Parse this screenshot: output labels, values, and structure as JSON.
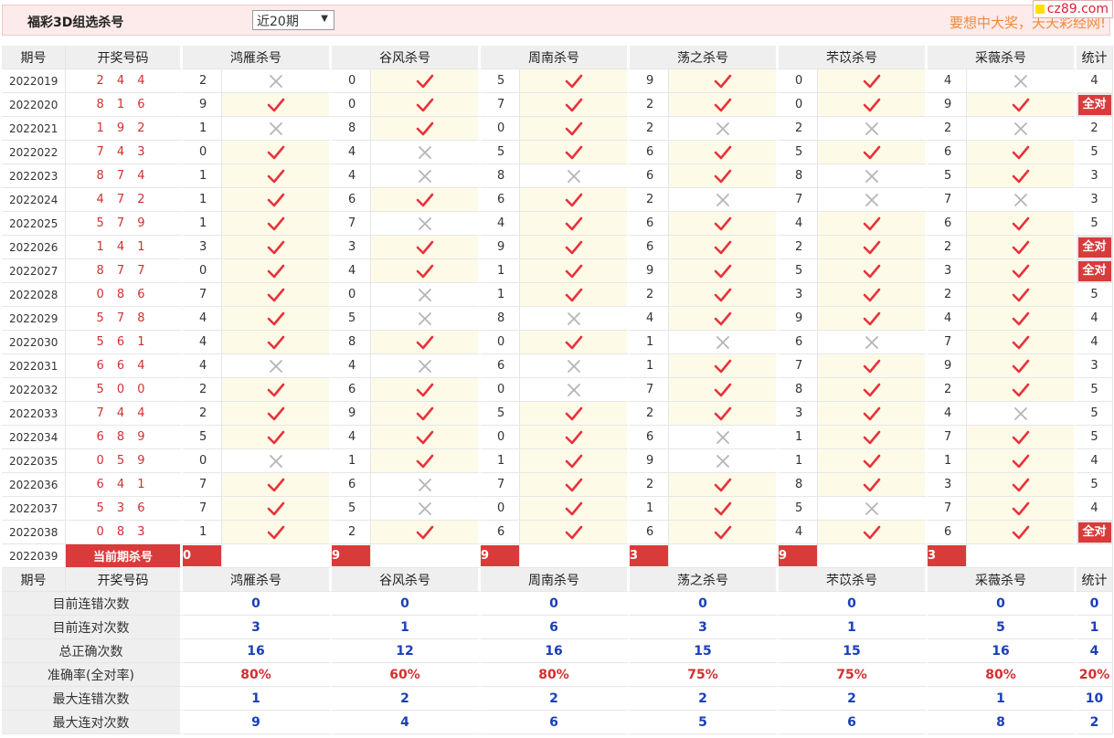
{
  "header": {
    "title": "福彩3D组选杀号",
    "select_value": "近20期",
    "slogan": "要想中大奖，天天彩经网!",
    "logo": "cz89.com"
  },
  "columns": {
    "issue": "期号",
    "winning": "开奖号码",
    "experts": [
      "鸿雁杀号",
      "谷风杀号",
      "周南杀号",
      "荡之杀号",
      "芣苡杀号",
      "采薇杀号"
    ],
    "stat": "统计"
  },
  "all_correct_label": "全对",
  "current_label": "当前期杀号",
  "rows": [
    {
      "issue": "2022019",
      "win": "2 4 4",
      "kills": [
        2,
        0,
        5,
        9,
        0,
        4
      ],
      "ok": [
        0,
        1,
        1,
        1,
        1,
        0
      ],
      "stat": "4"
    },
    {
      "issue": "2022020",
      "win": "8 1 6",
      "kills": [
        9,
        0,
        7,
        2,
        0,
        9
      ],
      "ok": [
        1,
        1,
        1,
        1,
        1,
        1
      ],
      "stat": "全对"
    },
    {
      "issue": "2022021",
      "win": "1 9 2",
      "kills": [
        1,
        8,
        0,
        2,
        2,
        2
      ],
      "ok": [
        0,
        1,
        1,
        0,
        0,
        0
      ],
      "stat": "2"
    },
    {
      "issue": "2022022",
      "win": "7 4 3",
      "kills": [
        0,
        4,
        5,
        6,
        5,
        6
      ],
      "ok": [
        1,
        0,
        1,
        1,
        1,
        1
      ],
      "stat": "5"
    },
    {
      "issue": "2022023",
      "win": "8 7 4",
      "kills": [
        1,
        4,
        8,
        6,
        8,
        5
      ],
      "ok": [
        1,
        0,
        0,
        1,
        0,
        1
      ],
      "stat": "3"
    },
    {
      "issue": "2022024",
      "win": "4 7 2",
      "kills": [
        1,
        6,
        6,
        2,
        7,
        7
      ],
      "ok": [
        1,
        1,
        1,
        0,
        0,
        0
      ],
      "stat": "3"
    },
    {
      "issue": "2022025",
      "win": "5 7 9",
      "kills": [
        1,
        7,
        4,
        6,
        4,
        6
      ],
      "ok": [
        1,
        0,
        1,
        1,
        1,
        1
      ],
      "stat": "5"
    },
    {
      "issue": "2022026",
      "win": "1 4 1",
      "kills": [
        3,
        3,
        9,
        6,
        2,
        2
      ],
      "ok": [
        1,
        1,
        1,
        1,
        1,
        1
      ],
      "stat": "全对"
    },
    {
      "issue": "2022027",
      "win": "8 7 7",
      "kills": [
        0,
        4,
        1,
        9,
        5,
        3
      ],
      "ok": [
        1,
        1,
        1,
        1,
        1,
        1
      ],
      "stat": "全对"
    },
    {
      "issue": "2022028",
      "win": "0 8 6",
      "kills": [
        7,
        0,
        1,
        2,
        3,
        2
      ],
      "ok": [
        1,
        0,
        1,
        1,
        1,
        1
      ],
      "stat": "5"
    },
    {
      "issue": "2022029",
      "win": "5 7 8",
      "kills": [
        4,
        5,
        8,
        4,
        9,
        4
      ],
      "ok": [
        1,
        0,
        0,
        1,
        1,
        1
      ],
      "stat": "4"
    },
    {
      "issue": "2022030",
      "win": "5 6 1",
      "kills": [
        4,
        8,
        0,
        1,
        6,
        7
      ],
      "ok": [
        1,
        1,
        1,
        0,
        0,
        1
      ],
      "stat": "4"
    },
    {
      "issue": "2022031",
      "win": "6 6 4",
      "kills": [
        4,
        4,
        6,
        1,
        7,
        9
      ],
      "ok": [
        0,
        0,
        0,
        1,
        1,
        1
      ],
      "stat": "3"
    },
    {
      "issue": "2022032",
      "win": "5 0 0",
      "kills": [
        2,
        6,
        0,
        7,
        8,
        2
      ],
      "ok": [
        1,
        1,
        0,
        1,
        1,
        1
      ],
      "stat": "5"
    },
    {
      "issue": "2022033",
      "win": "7 4 4",
      "kills": [
        2,
        9,
        5,
        2,
        3,
        4
      ],
      "ok": [
        1,
        1,
        1,
        1,
        1,
        0
      ],
      "stat": "5"
    },
    {
      "issue": "2022034",
      "win": "6 8 9",
      "kills": [
        5,
        4,
        0,
        6,
        1,
        7
      ],
      "ok": [
        1,
        1,
        1,
        0,
        1,
        1
      ],
      "stat": "5"
    },
    {
      "issue": "2022035",
      "win": "0 5 9",
      "kills": [
        0,
        1,
        1,
        9,
        1,
        1
      ],
      "ok": [
        0,
        1,
        1,
        0,
        1,
        1
      ],
      "stat": "4"
    },
    {
      "issue": "2022036",
      "win": "6 4 1",
      "kills": [
        7,
        6,
        7,
        2,
        8,
        3
      ],
      "ok": [
        1,
        0,
        1,
        1,
        1,
        1
      ],
      "stat": "5"
    },
    {
      "issue": "2022037",
      "win": "5 3 6",
      "kills": [
        7,
        5,
        0,
        1,
        5,
        7
      ],
      "ok": [
        1,
        0,
        1,
        1,
        0,
        1
      ],
      "stat": "4"
    },
    {
      "issue": "2022038",
      "win": "0 8 3",
      "kills": [
        1,
        2,
        6,
        6,
        4,
        6
      ],
      "ok": [
        1,
        1,
        1,
        1,
        1,
        1
      ],
      "stat": "全对"
    }
  ],
  "current": {
    "issue": "2022039",
    "kills": [
      "0",
      "9",
      "9",
      "3",
      "9",
      "3"
    ]
  },
  "summary": [
    {
      "label": "目前连错次数",
      "values": [
        "0",
        "0",
        "0",
        "0",
        "0",
        "0",
        "0"
      ],
      "red": false
    },
    {
      "label": "目前连对次数",
      "values": [
        "3",
        "1",
        "6",
        "3",
        "1",
        "5",
        "1"
      ],
      "red": false
    },
    {
      "label": "总正确次数",
      "values": [
        "16",
        "12",
        "16",
        "15",
        "15",
        "16",
        "4"
      ],
      "red": false
    },
    {
      "label": "准确率(全对率)",
      "values": [
        "80%",
        "60%",
        "80%",
        "75%",
        "75%",
        "80%",
        "20%"
      ],
      "red": true
    },
    {
      "label": "最大连错次数",
      "values": [
        "1",
        "2",
        "2",
        "2",
        "2",
        "1",
        "10"
      ],
      "red": false
    },
    {
      "label": "最大连对次数",
      "values": [
        "9",
        "4",
        "6",
        "5",
        "6",
        "8",
        "2"
      ],
      "red": false
    }
  ],
  "colors": {
    "check": "#e8323c",
    "cross": "#b5b5b5",
    "badge": "#d93b3b",
    "summary_blue": "#1a3fb8"
  }
}
